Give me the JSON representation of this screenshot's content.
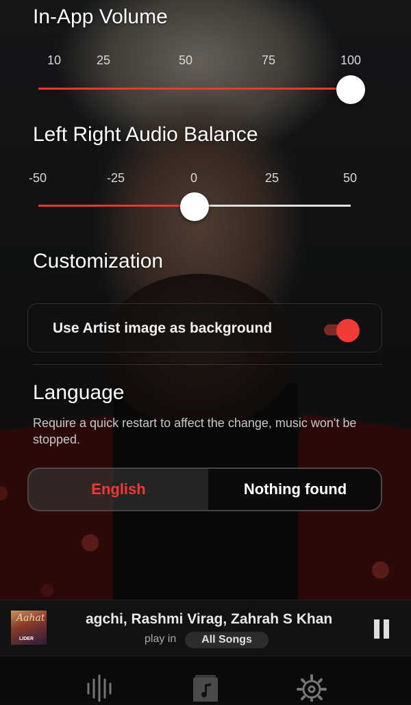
{
  "volume": {
    "title": "In-App Volume",
    "ticks": [
      "10",
      "25",
      "50",
      "75",
      "100"
    ],
    "value": 100,
    "range": [
      10,
      100
    ]
  },
  "balance": {
    "title": "Left Right Audio Balance",
    "ticks": [
      "-50",
      "-25",
      "0",
      "25",
      "50"
    ],
    "value": 0,
    "range": [
      -50,
      50
    ]
  },
  "customization": {
    "title": "Customization",
    "artist_bg_label": "Use Artist image as background",
    "artist_bg_enabled": true
  },
  "language": {
    "title": "Language",
    "description": "Require a quick restart to affect the change, music won't be stopped.",
    "selected": "English",
    "other": "Nothing found"
  },
  "player": {
    "song_text": "agchi, Rashmi Virag, Zahrah S Khan",
    "play_in_label": "play in",
    "playlist": "All Songs",
    "album_art_title": "Aahat",
    "album_art_tag": "LIDER"
  },
  "bottom_nav": {
    "items": [
      "equalizer-icon",
      "music-library-icon",
      "settings-icon"
    ],
    "active": "music-library-icon"
  },
  "colors": {
    "accent": "#f03a33",
    "track": "#e0e0e0",
    "player_bg": "#121212"
  }
}
